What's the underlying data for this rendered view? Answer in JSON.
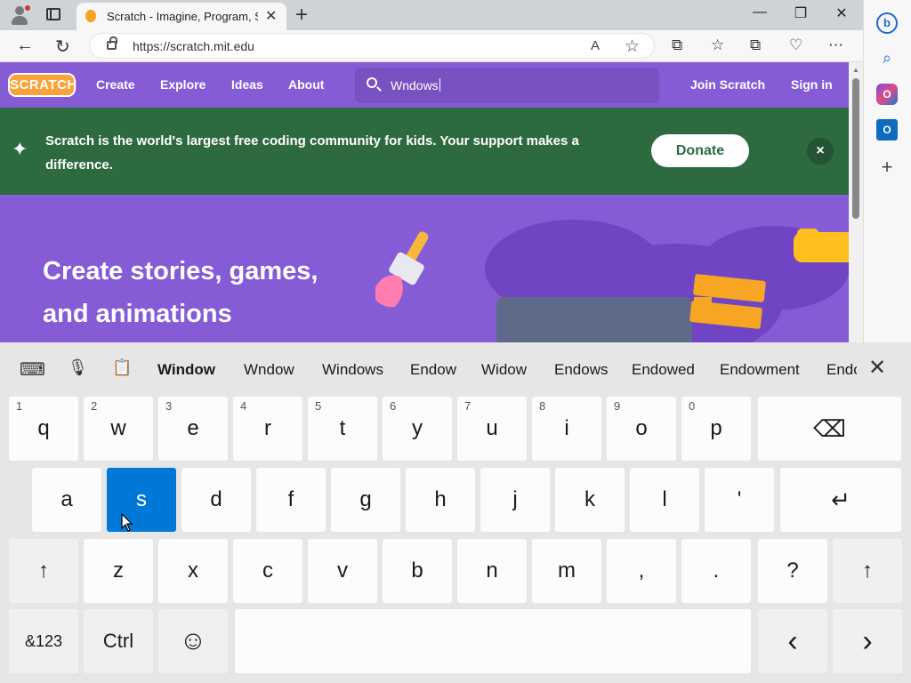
{
  "browser": {
    "tab_title": "Scratch - Imagine, Program, Share",
    "tab_close": "✕",
    "new_tab": "+",
    "url": "https://scratch.mit.edu",
    "window_controls": {
      "minimize": "—",
      "restore": "❐",
      "close": "✕"
    },
    "icons": [
      "profile-icon",
      "tab-actions-icon",
      "back-icon",
      "refresh-icon",
      "read-aloud-icon",
      "favorite-icon",
      "split-screen-icon",
      "favorites-icon",
      "collections-icon",
      "browser-essentials-icon",
      "more-icon"
    ],
    "glyphs": {
      "back": "←",
      "refresh": "↻",
      "read_aloud": "A",
      "favorite": "☆",
      "split": "⧉",
      "favorites": "☆",
      "collections": "⧉",
      "essentials": "♡",
      "more": "⋯"
    }
  },
  "sidebar": {
    "icons": [
      "bing-icon",
      "search-icon",
      "office-icon",
      "outlook-icon",
      "add-icon"
    ],
    "glyphs": {
      "bing": "b",
      "search": "⌕",
      "office": "O",
      "outlook": "O",
      "add": "+"
    }
  },
  "scratch": {
    "logo": "SCRATCH",
    "nav": {
      "create": "Create",
      "explore": "Explore",
      "ideas": "Ideas",
      "about": "About",
      "join": "Join Scratch",
      "signin": "Sign in"
    },
    "search_value": "Wndows",
    "banner": {
      "text": "Scratch is the world's largest free coding community for kids. Your support makes a difference.",
      "donate": "Donate",
      "close": "×"
    },
    "hero": {
      "title": "Create stories, games, and animations"
    }
  },
  "keyboard": {
    "suggestions": [
      "Window",
      "Wndow",
      "Windows",
      "Endow",
      "Widow",
      "Endows",
      "Endowed",
      "Endowment",
      "Endo"
    ],
    "row1": [
      {
        "hint": "1",
        "label": "q"
      },
      {
        "hint": "2",
        "label": "w"
      },
      {
        "hint": "3",
        "label": "e"
      },
      {
        "hint": "4",
        "label": "r"
      },
      {
        "hint": "5",
        "label": "t"
      },
      {
        "hint": "6",
        "label": "y"
      },
      {
        "hint": "7",
        "label": "u"
      },
      {
        "hint": "8",
        "label": "i"
      },
      {
        "hint": "9",
        "label": "o"
      },
      {
        "hint": "0",
        "label": "p"
      }
    ],
    "row2": [
      "a",
      "s",
      "d",
      "f",
      "g",
      "h",
      "j",
      "k",
      "l",
      "'"
    ],
    "row3": [
      "z",
      "x",
      "c",
      "v",
      "b",
      "n",
      "m",
      ",",
      ".",
      "?"
    ],
    "labels": {
      "backspace": "⌫",
      "enter": "↵",
      "shift": "↑",
      "symbols": "&123",
      "ctrl": "Ctrl",
      "emoji": "☺",
      "left": "‹",
      "right": "›",
      "close": "✕",
      "mic": "🎙",
      "clipboard": "📋",
      "keyboard_settings": "⌨"
    },
    "active_key": "s"
  },
  "colors": {
    "scratch_purple": "#855cd6",
    "banner_green": "#2d6a40",
    "key_active": "#0078d7"
  }
}
